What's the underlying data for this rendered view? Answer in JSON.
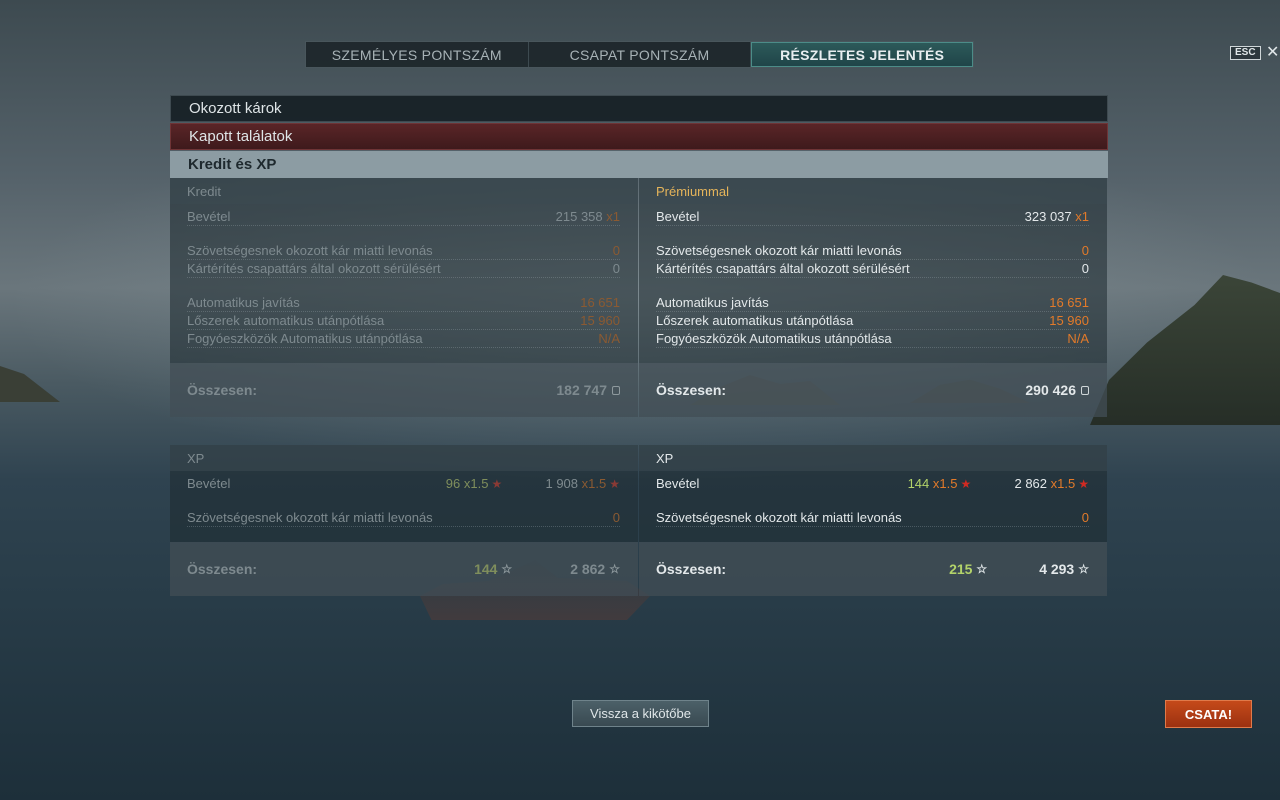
{
  "tabs": [
    {
      "label": "SZEMÉLYES PONTSZÁM"
    },
    {
      "label": "CSAPAT PONTSZÁM"
    },
    {
      "label": "RÉSZLETES JELENTÉS"
    }
  ],
  "esc_label": "ESC",
  "close_glyph": "✕",
  "sections": {
    "damage_caused": "Okozott károk",
    "hits_received": "Kapott találatok",
    "credits_xp": "Kredit és XP"
  },
  "credits": {
    "base": {
      "title": "Kredit",
      "income_label": "Bevétel",
      "income_value": "215 358",
      "income_mult": "x1",
      "ally_damage_label": "Szövetségesnek okozott kár miatti levonás",
      "ally_damage_value": "0",
      "compensation_label": "Kártérítés csapattárs által okozott sérülésért",
      "compensation_value": "0",
      "auto_repair_label": "Automatikus javítás",
      "auto_repair_value": "16 651",
      "auto_ammo_label": "Lőszerek automatikus utánpótlása",
      "auto_ammo_value": "15 960",
      "auto_consumables_label": "Fogyóeszközök Automatikus utánpótlása",
      "auto_consumables_value": "N/A",
      "total_label": "Összesen:",
      "total_value": "182 747"
    },
    "premium": {
      "title": "Prémiummal",
      "income_label": "Bevétel",
      "income_value": "323 037",
      "income_mult": "x1",
      "ally_damage_label": "Szövetségesnek okozott kár miatti levonás",
      "ally_damage_value": "0",
      "compensation_label": "Kártérítés csapattárs által okozott sérülésért",
      "compensation_value": "0",
      "auto_repair_label": "Automatikus javítás",
      "auto_repair_value": "16 651",
      "auto_ammo_label": "Lőszerek automatikus utánpótlása",
      "auto_ammo_value": "15 960",
      "auto_consumables_label": "Fogyóeszközök Automatikus utánpótlása",
      "auto_consumables_value": "N/A",
      "total_label": "Összesen:",
      "total_value": "290 426"
    }
  },
  "xp": {
    "base": {
      "title": "XP",
      "income_label": "Bevétel",
      "income_xp": "96",
      "income_xp_mult": "x1.5",
      "income_free": "1 908",
      "income_free_mult": "x1.5",
      "ally_damage_label": "Szövetségesnek okozott kár miatti levonás",
      "ally_damage_value": "0",
      "total_label": "Összesen:",
      "total_xp": "144",
      "total_free": "2 862"
    },
    "premium": {
      "title": "XP",
      "income_label": "Bevétel",
      "income_xp": "144",
      "income_xp_mult": "x1.5",
      "income_free": "2 862",
      "income_free_mult": "x1.5",
      "ally_damage_label": "Szövetségesnek okozott kár miatti levonás",
      "ally_damage_value": "0",
      "total_label": "Összesen:",
      "total_xp": "215",
      "total_free": "4 293"
    }
  },
  "buttons": {
    "back_to_port": "Vissza a kikötőbe",
    "battle": "CSATA!"
  },
  "icons": {
    "star": "★",
    "star_outline": "☆"
  }
}
